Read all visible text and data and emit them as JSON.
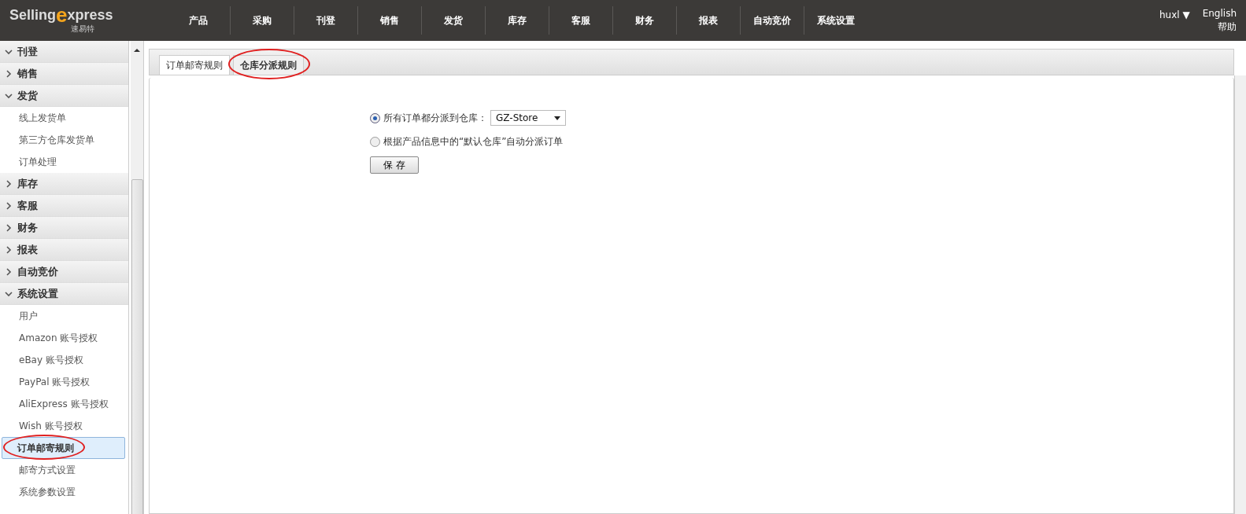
{
  "header": {
    "logo": {
      "word_a": "Selling",
      "word_b": "xpress",
      "mark": "e",
      "subtitle": "速易特"
    },
    "nav": [
      {
        "label": "产品"
      },
      {
        "label": "采购"
      },
      {
        "label": "刊登"
      },
      {
        "label": "销售"
      },
      {
        "label": "发货"
      },
      {
        "label": "库存"
      },
      {
        "label": "客服"
      },
      {
        "label": "财务"
      },
      {
        "label": "报表"
      },
      {
        "label": "自动竞价"
      },
      {
        "label": "系统设置"
      }
    ],
    "user": "huxl ▼",
    "language": "English",
    "help": "帮助"
  },
  "sidebar": {
    "sections": [
      {
        "label": "刊登",
        "expanded": true
      },
      {
        "label": "销售",
        "expanded": false
      },
      {
        "label": "发货",
        "expanded": true,
        "children": [
          {
            "label": "线上发货单",
            "selected": false
          },
          {
            "label": "第三方仓库发货单",
            "selected": false
          },
          {
            "label": "订单处理",
            "selected": false
          }
        ]
      },
      {
        "label": "库存",
        "expanded": false
      },
      {
        "label": "客服",
        "expanded": false
      },
      {
        "label": "财务",
        "expanded": false
      },
      {
        "label": "报表",
        "expanded": false
      },
      {
        "label": "自动竞价",
        "expanded": false
      },
      {
        "label": "系统设置",
        "expanded": true,
        "children": [
          {
            "label": "用户",
            "selected": false
          },
          {
            "label": "Amazon 账号授权",
            "selected": false
          },
          {
            "label": "eBay 账号授权",
            "selected": false
          },
          {
            "label": "PayPal 账号授权",
            "selected": false
          },
          {
            "label": "AliExpress 账号授权",
            "selected": false
          },
          {
            "label": "Wish 账号授权",
            "selected": false
          },
          {
            "label": "订单邮寄规则",
            "selected": true,
            "circled": true
          },
          {
            "label": "邮寄方式设置",
            "selected": false
          },
          {
            "label": "系统参数设置",
            "selected": false
          }
        ]
      }
    ]
  },
  "tabs": [
    {
      "label": "订单邮寄规则",
      "selected": false,
      "circled": false
    },
    {
      "label": "仓库分派规则",
      "selected": true,
      "circled": true
    }
  ],
  "form": {
    "options": [
      {
        "label": "所有订单都分派到仓库：",
        "selected": true,
        "kind": "select",
        "value": "GZ-Store"
      },
      {
        "label": "根据产品信息中的“默认仓库”自动分派订单",
        "selected": false,
        "kind": "plain"
      }
    ],
    "save_button": "保 存"
  }
}
